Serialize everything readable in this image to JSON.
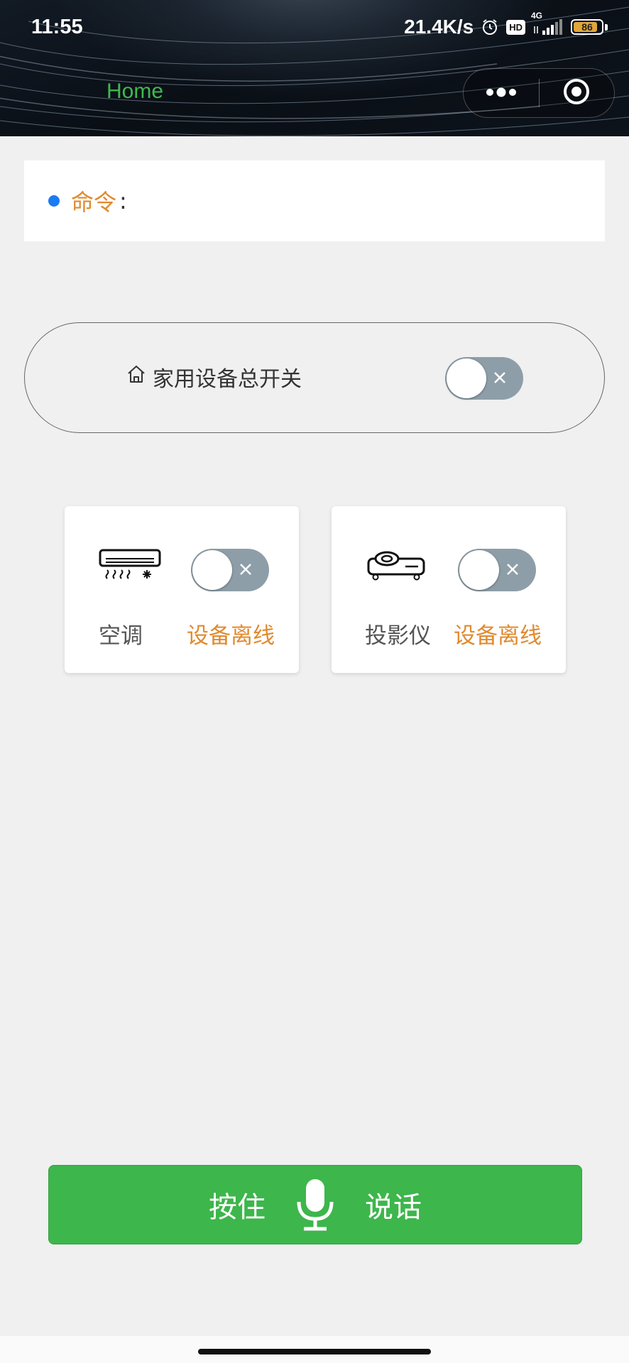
{
  "status_bar": {
    "time": "11:55",
    "net_speed": "21.4K/s",
    "hd": "HD",
    "network": "4G",
    "battery": "86",
    "battery_level_percent": 86,
    "icons": [
      "alarm-icon",
      "hd-icon",
      "signal-icon",
      "battery-icon"
    ]
  },
  "nav": {
    "title": "Home",
    "title_color": "#3fb94e",
    "capsule": [
      "more-icon",
      "close-miniprogram-icon"
    ]
  },
  "command": {
    "label": "命令",
    "colon": ":",
    "value": "",
    "dot_color": "#1a7cf2",
    "label_color": "#e08a2e"
  },
  "master_switch": {
    "icon": "home-icon",
    "label": "家用设备总开关",
    "on": false
  },
  "devices": [
    {
      "name": "空调",
      "icon": "air-conditioner-icon",
      "status": "设备离线",
      "on": false
    },
    {
      "name": "投影仪",
      "icon": "projector-icon",
      "status": "设备离线",
      "on": false
    }
  ],
  "voice_button": {
    "left_text": "按住",
    "right_text": "说话",
    "icon": "microphone-icon",
    "color": "#3db64b"
  }
}
